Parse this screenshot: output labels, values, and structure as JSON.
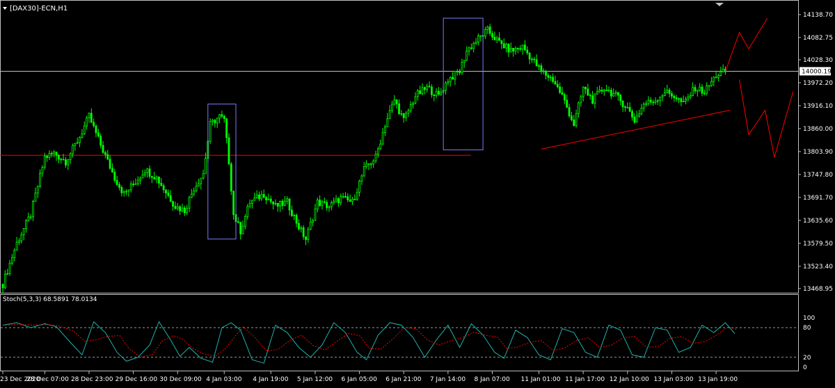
{
  "window": {
    "title": "[DAX30]-ECN,H1",
    "current_price": "14000.19"
  },
  "colors": {
    "background": "#000000",
    "axis": "#c0c0c0",
    "bull_candle": "#00ff00",
    "bear_candle": "#00ff00",
    "support_line": "#ff0000",
    "box": "#7b7bff",
    "price_line": "#c0c0c0",
    "stoch_main": "#20b2aa",
    "stoch_signal": "#ff0000",
    "current_marker": "#000000"
  },
  "chart_data": [
    {
      "type": "candlestick",
      "symbol": "[DAX30]-ECN",
      "timeframe": "H1",
      "ylim": [
        13468.95,
        14137.0
      ],
      "y_ticks": [
        "14138.70",
        "14082.75",
        "14028.30",
        "13972.20",
        "13916.10",
        "13860.00",
        "13803.90",
        "13747.80",
        "13691.70",
        "13635.60",
        "13579.50",
        "13523.40",
        "13468.95"
      ],
      "x_ticks": [
        "23 Dec 2020",
        "28 Dec 07:00",
        "28 Dec 23:00",
        "29 Dec 16:00",
        "30 Dec 09:00",
        "4 Jan 03:00",
        "4 Jan 19:00",
        "5 Jan 12:00",
        "6 Jan 05:00",
        "6 Jan 21:00",
        "7 Jan 14:00",
        "8 Jan 07:00",
        "11 Jan 01:00",
        "11 Jan 17:00",
        "12 Jan 10:00",
        "13 Jan 03:00",
        "13 Jan 19:00"
      ],
      "x_tick_index": [
        0,
        18,
        37,
        56,
        75,
        95,
        115,
        134,
        153,
        172,
        191,
        210,
        230,
        249,
        268,
        287,
        306
      ],
      "horizontal_level": 13795,
      "current_price_value": 14000.19,
      "close_path": [
        [
          0,
          13480
        ],
        [
          6,
          13580
        ],
        [
          12,
          13650
        ],
        [
          18,
          13790
        ],
        [
          22,
          13800
        ],
        [
          27,
          13780
        ],
        [
          33,
          13840
        ],
        [
          37,
          13890
        ],
        [
          42,
          13820
        ],
        [
          48,
          13740
        ],
        [
          52,
          13700
        ],
        [
          57,
          13730
        ],
        [
          61,
          13760
        ],
        [
          66,
          13740
        ],
        [
          70,
          13705
        ],
        [
          74,
          13670
        ],
        [
          78,
          13660
        ],
        [
          82,
          13715
        ],
        [
          86,
          13750
        ],
        [
          89,
          13870
        ],
        [
          93,
          13890
        ],
        [
          95,
          13880
        ],
        [
          97,
          13780
        ],
        [
          99,
          13650
        ],
        [
          102,
          13610
        ],
        [
          106,
          13680
        ],
        [
          112,
          13700
        ],
        [
          117,
          13670
        ],
        [
          122,
          13680
        ],
        [
          127,
          13620
        ],
        [
          130,
          13590
        ],
        [
          135,
          13680
        ],
        [
          140,
          13670
        ],
        [
          145,
          13690
        ],
        [
          150,
          13680
        ],
        [
          155,
          13760
        ],
        [
          160,
          13790
        ],
        [
          164,
          13870
        ],
        [
          168,
          13930
        ],
        [
          172,
          13880
        ],
        [
          177,
          13940
        ],
        [
          182,
          13960
        ],
        [
          187,
          13940
        ],
        [
          191,
          13980
        ],
        [
          196,
          14000
        ],
        [
          199,
          14050
        ],
        [
          204,
          14080
        ],
        [
          208,
          14100
        ],
        [
          213,
          14070
        ],
        [
          218,
          14050
        ],
        [
          223,
          14060
        ],
        [
          227,
          14030
        ],
        [
          231,
          14000
        ],
        [
          236,
          13980
        ],
        [
          240,
          13940
        ],
        [
          245,
          13870
        ],
        [
          249,
          13960
        ],
        [
          253,
          13930
        ],
        [
          258,
          13960
        ],
        [
          263,
          13940
        ],
        [
          268,
          13910
        ],
        [
          271,
          13880
        ],
        [
          275,
          13920
        ],
        [
          280,
          13930
        ],
        [
          284,
          13950
        ],
        [
          288,
          13940
        ],
        [
          292,
          13920
        ],
        [
          297,
          13960
        ],
        [
          301,
          13950
        ],
        [
          306,
          13990
        ],
        [
          310,
          14000
        ]
      ],
      "boxes": [
        {
          "i0": 88,
          "i1": 100,
          "ymin": 13590,
          "ymax": 13920
        },
        {
          "i0": 189,
          "i1": 206,
          "ymin": 13808,
          "ymax": 14130
        }
      ],
      "drawn_lines": [
        {
          "points": [
            [
              231,
              13810
            ],
            [
              312,
              13905
            ]
          ]
        }
      ],
      "projection_paths": [
        {
          "points": [
            [
              310,
              14000
            ],
            [
              316,
              14095
            ],
            [
              320,
              14055
            ],
            [
              328,
              14130
            ]
          ]
        },
        {
          "points": [
            [
              316,
              13980
            ],
            [
              320,
              13845
            ],
            [
              327,
              13905
            ],
            [
              331,
              13790
            ],
            [
              339,
              13950
            ]
          ]
        }
      ]
    },
    {
      "type": "line",
      "indicator": "Stoch(5,3,3)",
      "label": "Stoch(5,3,3) 68.5891 78.0134",
      "ylim": [
        0,
        100
      ],
      "y_ticks": [
        "100",
        "80",
        "20",
        "0"
      ],
      "levels": [
        80,
        20
      ],
      "series": [
        {
          "name": "main"
        },
        {
          "name": "signal"
        }
      ],
      "points": [
        [
          0,
          85
        ],
        [
          6,
          90
        ],
        [
          12,
          80
        ],
        [
          18,
          88
        ],
        [
          23,
          82
        ],
        [
          29,
          50
        ],
        [
          34,
          25
        ],
        [
          39,
          92
        ],
        [
          44,
          70
        ],
        [
          49,
          30
        ],
        [
          53,
          12
        ],
        [
          58,
          20
        ],
        [
          63,
          45
        ],
        [
          67,
          92
        ],
        [
          72,
          55
        ],
        [
          76,
          22
        ],
        [
          80,
          40
        ],
        [
          85,
          18
        ],
        [
          90,
          10
        ],
        [
          94,
          80
        ],
        [
          98,
          90
        ],
        [
          102,
          75
        ],
        [
          107,
          15
        ],
        [
          112,
          8
        ],
        [
          117,
          85
        ],
        [
          122,
          70
        ],
        [
          127,
          40
        ],
        [
          132,
          20
        ],
        [
          137,
          45
        ],
        [
          142,
          90
        ],
        [
          147,
          70
        ],
        [
          152,
          30
        ],
        [
          156,
          15
        ],
        [
          161,
          65
        ],
        [
          166,
          90
        ],
        [
          171,
          85
        ],
        [
          176,
          60
        ],
        [
          181,
          20
        ],
        [
          186,
          55
        ],
        [
          191,
          85
        ],
        [
          196,
          40
        ],
        [
          201,
          88
        ],
        [
          206,
          65
        ],
        [
          211,
          30
        ],
        [
          215,
          18
        ],
        [
          220,
          75
        ],
        [
          225,
          60
        ],
        [
          230,
          25
        ],
        [
          235,
          15
        ],
        [
          240,
          78
        ],
        [
          245,
          70
        ],
        [
          250,
          30
        ],
        [
          255,
          20
        ],
        [
          260,
          85
        ],
        [
          265,
          75
        ],
        [
          270,
          25
        ],
        [
          275,
          20
        ],
        [
          280,
          80
        ],
        [
          285,
          75
        ],
        [
          290,
          30
        ],
        [
          295,
          40
        ],
        [
          300,
          85
        ],
        [
          305,
          70
        ],
        [
          310,
          90
        ],
        [
          314,
          68
        ]
      ]
    }
  ]
}
